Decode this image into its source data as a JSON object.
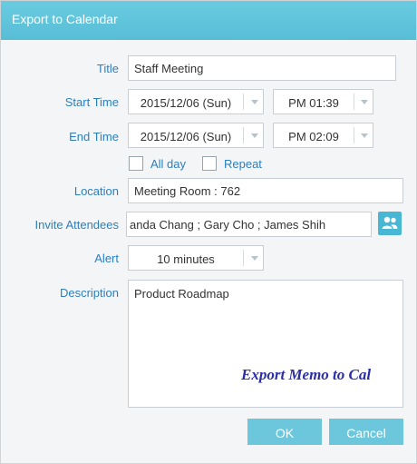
{
  "window": {
    "title": "Export to Calendar"
  },
  "form": {
    "title": {
      "label": "Title",
      "value": "Staff Meeting"
    },
    "start_time": {
      "label": "Start Time",
      "date": "2015/12/06 (Sun)",
      "time": "PM 01:39"
    },
    "end_time": {
      "label": "End Time",
      "date": "2015/12/06 (Sun)",
      "time": "PM 02:09"
    },
    "all_day": {
      "label": "All day",
      "checked": false
    },
    "repeat": {
      "label": "Repeat",
      "checked": false
    },
    "location": {
      "label": "Location",
      "value": "Meeting Room : 762"
    },
    "invite_attendees": {
      "label": "Invite Attendees",
      "value": "anda Chang ; Gary Cho ; James Shih"
    },
    "alert": {
      "label": "Alert",
      "value": "10 minutes"
    },
    "description": {
      "label": "Description",
      "value": "Product Roadmap"
    }
  },
  "overlay_caption": "Export Memo to Cal",
  "buttons": {
    "ok": "OK",
    "cancel": "Cancel"
  },
  "icons": {
    "contacts": "people-icon",
    "dropdown": "chevron-down-icon"
  },
  "colors": {
    "title_bar": "#5fc4db",
    "label": "#2b7fbf",
    "button": "#6cc6dc",
    "caption": "#2b2fa6"
  }
}
